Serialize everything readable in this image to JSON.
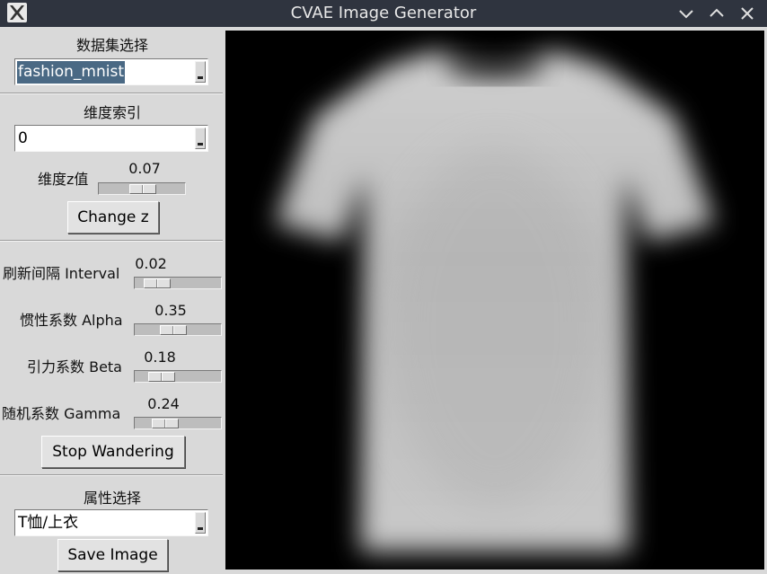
{
  "window": {
    "title": "CVAE Image Generator"
  },
  "dataset": {
    "label": "数据集选择",
    "value": "fashion_mnist"
  },
  "dimension": {
    "label": "维度索引",
    "value": "0"
  },
  "z_slider": {
    "label": "维度z值",
    "value": "0.07",
    "fraction": 0.52
  },
  "change_z_button": "Change z",
  "interval": {
    "label": "刷新间隔 Interval",
    "value": "0.02",
    "fraction": 0.15
  },
  "alpha": {
    "label": "惯性系数 Alpha",
    "value": "0.35",
    "fraction": 0.42
  },
  "beta": {
    "label": "引力系数 Beta",
    "value": "0.18",
    "fraction": 0.22
  },
  "gamma": {
    "label": "随机系数 Gamma",
    "value": "0.24",
    "fraction": 0.29
  },
  "stop_button": "Stop Wandering",
  "attribute": {
    "label": "属性选择",
    "value": "T恤/上衣"
  },
  "save_button": "Save Image",
  "colors": {
    "titlebar": "#2f343f",
    "background": "#d9d9d9",
    "selection": "#4a6984",
    "canvas": "#000000"
  },
  "icons": {
    "app": "x11-app-icon",
    "minimize": "chevron-down-icon",
    "maximize": "chevron-up-icon",
    "close": "close-icon"
  }
}
